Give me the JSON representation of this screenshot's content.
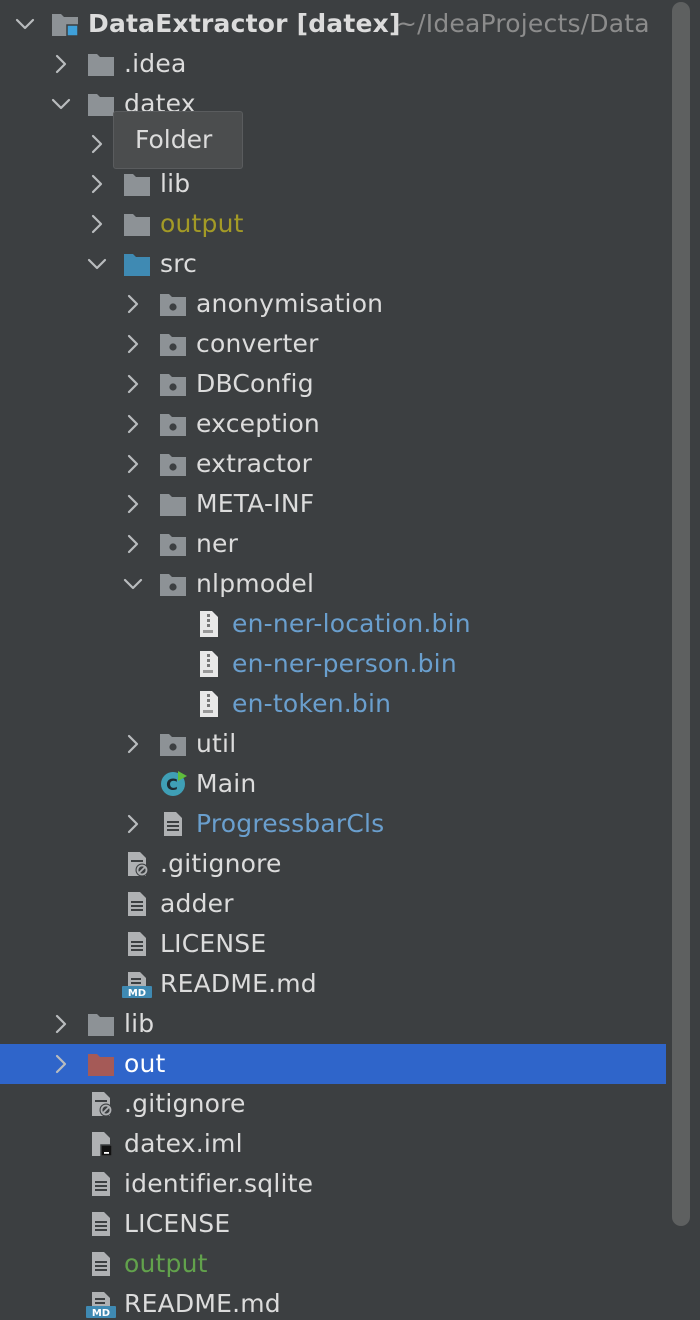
{
  "tooltip": {
    "text": "Folder"
  },
  "rows": [
    {
      "text": "DataExtractor [datex]",
      "suffix": "~/IdeaProjects/Data",
      "level": 0,
      "chevron": "down",
      "icon": "module-folder-icon",
      "color": "bold",
      "name": "tree-node-dataextractor"
    },
    {
      "text": ".idea",
      "level": 1,
      "chevron": "right",
      "icon": "folder-icon",
      "color": "",
      "name": "tree-node-idea"
    },
    {
      "text": "datex",
      "level": 1,
      "chevron": "down",
      "icon": "folder-icon",
      "color": "",
      "name": "tree-node-datex"
    },
    {
      "text": "",
      "level": 2,
      "chevron": "right",
      "icon": "none",
      "color": "",
      "name": "tree-node-hidden-by-tooltip"
    },
    {
      "text": "lib",
      "level": 2,
      "chevron": "right",
      "icon": "folder-icon",
      "color": "",
      "name": "tree-node-lib-inner"
    },
    {
      "text": "output",
      "level": 2,
      "chevron": "right",
      "icon": "folder-icon",
      "color": "yellow",
      "name": "tree-node-output-folder"
    },
    {
      "text": "src",
      "level": 2,
      "chevron": "down",
      "icon": "source-folder-icon",
      "color": "",
      "name": "tree-node-src"
    },
    {
      "text": "anonymisation",
      "level": 3,
      "chevron": "right",
      "icon": "package-icon",
      "color": "",
      "name": "tree-node-anonymisation"
    },
    {
      "text": "converter",
      "level": 3,
      "chevron": "right",
      "icon": "package-icon",
      "color": "",
      "name": "tree-node-converter"
    },
    {
      "text": "DBConfig",
      "level": 3,
      "chevron": "right",
      "icon": "package-icon",
      "color": "",
      "name": "tree-node-dbconfig"
    },
    {
      "text": "exception",
      "level": 3,
      "chevron": "right",
      "icon": "package-icon",
      "color": "",
      "name": "tree-node-exception"
    },
    {
      "text": "extractor",
      "level": 3,
      "chevron": "right",
      "icon": "package-icon",
      "color": "",
      "name": "tree-node-extractor"
    },
    {
      "text": "META-INF",
      "level": 3,
      "chevron": "right",
      "icon": "folder-icon",
      "color": "",
      "name": "tree-node-meta-inf"
    },
    {
      "text": "ner",
      "level": 3,
      "chevron": "right",
      "icon": "package-icon",
      "color": "",
      "name": "tree-node-ner"
    },
    {
      "text": "nlpmodel",
      "level": 3,
      "chevron": "down",
      "icon": "package-icon",
      "color": "",
      "name": "tree-node-nlpmodel"
    },
    {
      "text": "en-ner-location.bin",
      "level": 4,
      "chevron": "none",
      "icon": "binary-file-icon",
      "color": "blue",
      "name": "tree-node-en-ner-location"
    },
    {
      "text": "en-ner-person.bin",
      "level": 4,
      "chevron": "none",
      "icon": "binary-file-icon",
      "color": "blue",
      "name": "tree-node-en-ner-person"
    },
    {
      "text": "en-token.bin",
      "level": 4,
      "chevron": "none",
      "icon": "binary-file-icon",
      "color": "blue",
      "name": "tree-node-en-token"
    },
    {
      "text": "util",
      "level": 3,
      "chevron": "right",
      "icon": "package-icon",
      "color": "",
      "name": "tree-node-util"
    },
    {
      "text": "Main",
      "level": 3,
      "chevron": "none",
      "icon": "java-class-icon",
      "color": "",
      "name": "tree-node-main"
    },
    {
      "text": "ProgressbarCls",
      "level": 3,
      "chevron": "right",
      "icon": "text-file-icon",
      "color": "blue",
      "name": "tree-node-progressbarcls"
    },
    {
      "text": ".gitignore",
      "level": 2,
      "chevron": "none",
      "icon": "ignore-file-icon",
      "color": "",
      "name": "tree-node-gitignore-inner"
    },
    {
      "text": "adder",
      "level": 2,
      "chevron": "none",
      "icon": "text-file-icon",
      "color": "",
      "name": "tree-node-adder"
    },
    {
      "text": "LICENSE",
      "level": 2,
      "chevron": "none",
      "icon": "text-file-icon",
      "color": "",
      "name": "tree-node-license-inner"
    },
    {
      "text": "README.md",
      "level": 2,
      "chevron": "none",
      "icon": "markdown-file-icon",
      "color": "",
      "name": "tree-node-readme-inner"
    },
    {
      "text": "lib",
      "level": 1,
      "chevron": "right",
      "icon": "folder-icon",
      "color": "",
      "name": "tree-node-lib"
    },
    {
      "text": "out",
      "level": 1,
      "chevron": "right",
      "icon": "excluded-folder-icon",
      "color": "white",
      "name": "tree-node-out",
      "selected": true
    },
    {
      "text": ".gitignore",
      "level": 1,
      "chevron": "none",
      "icon": "ignore-file-icon",
      "color": "",
      "name": "tree-node-gitignore"
    },
    {
      "text": "datex.iml",
      "level": 1,
      "chevron": "none",
      "icon": "iml-file-icon",
      "color": "",
      "name": "tree-node-datex-iml"
    },
    {
      "text": "identifier.sqlite",
      "level": 1,
      "chevron": "none",
      "icon": "text-file-icon",
      "color": "",
      "name": "tree-node-identifier-sqlite"
    },
    {
      "text": "LICENSE",
      "level": 1,
      "chevron": "none",
      "icon": "text-file-icon",
      "color": "",
      "name": "tree-node-license"
    },
    {
      "text": "output",
      "level": 1,
      "chevron": "none",
      "icon": "text-file-icon",
      "color": "green",
      "name": "tree-node-output-file"
    },
    {
      "text": "README.md",
      "level": 1,
      "chevron": "none",
      "icon": "markdown-file-icon",
      "color": "",
      "name": "tree-node-readme"
    }
  ],
  "colors": {
    "background": "#3c3f41",
    "selection": "#2f65ca",
    "folder": "#8d9296",
    "source_folder": "#3f8ab3",
    "excluded_folder": "#a55a57",
    "file": "#afb1b3",
    "java_class": "#3f9fb6"
  }
}
